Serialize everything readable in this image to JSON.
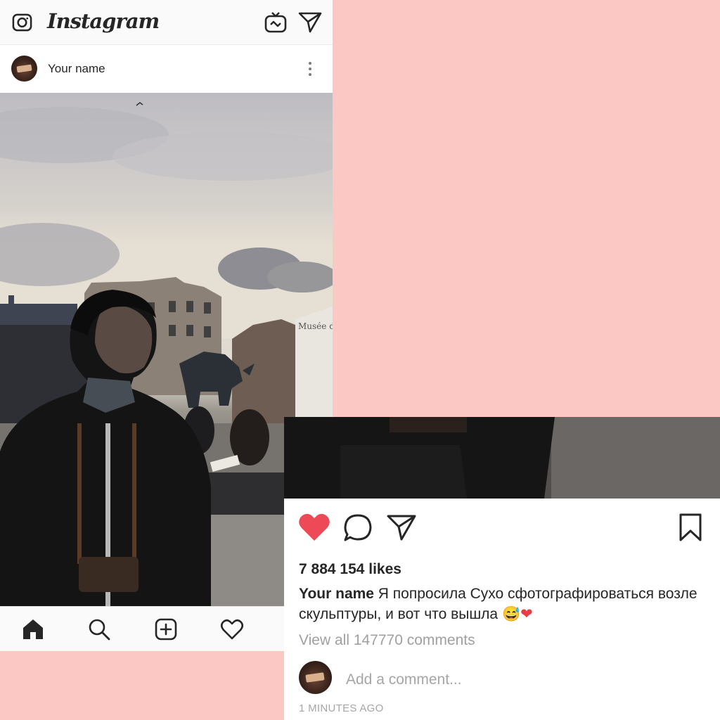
{
  "top_bar": {
    "title": "Instagram",
    "icons": [
      "camera-icon",
      "igtv-icon",
      "direct-message-icon"
    ]
  },
  "post": {
    "username": "Your name",
    "menu_icon": "more-options-icon",
    "image_sign_text": "Musée d'O"
  },
  "bottom_nav": {
    "icons": [
      "home-icon",
      "search-icon",
      "add-post-icon",
      "activity-heart-icon"
    ]
  },
  "actions": {
    "icons": [
      "like-heart-icon",
      "comment-icon",
      "share-icon",
      "bookmark-icon"
    ],
    "liked": true,
    "like_color": "#ed4956"
  },
  "likes": "7 884 154 likes",
  "caption": {
    "username": "Your name",
    "text": " Я попросила Сухо сфотографироваться возле скульптуры, и вот что вышла ",
    "emoji_1": "😅",
    "emoji_2": "❤"
  },
  "view_comments": "View all 147770 comments",
  "comment": {
    "placeholder": "Add a comment..."
  },
  "timestamp": "1 MINUTES AGO",
  "colors": {
    "background_pink": "#fcc8c3",
    "text": "#262626",
    "muted_text": "#a0a0a0"
  }
}
